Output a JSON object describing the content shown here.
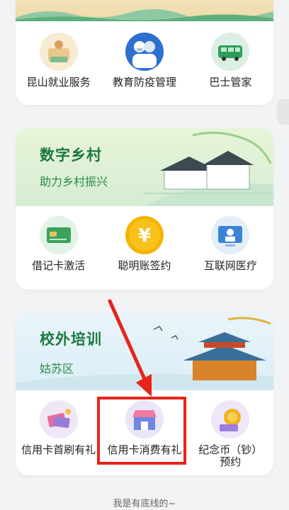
{
  "card1": {
    "items": [
      {
        "label": "昆山就业服务",
        "icon": "employment-service-icon"
      },
      {
        "label": "教育防疫管理",
        "icon": "epidemic-prevention-icon"
      },
      {
        "label": "巴士管家",
        "icon": "bus-icon"
      }
    ]
  },
  "card2": {
    "title": "数字乡村",
    "subtitle": "助力乡村振兴",
    "items": [
      {
        "label": "借记卡激活",
        "icon": "debit-card-icon"
      },
      {
        "label": "聪明账签约",
        "icon": "yuan-coin-icon"
      },
      {
        "label": "互联网医疗",
        "icon": "online-doctor-icon"
      }
    ]
  },
  "card3": {
    "title": "校外培训",
    "subtitle": "姑苏区",
    "items": [
      {
        "label": "信用卡首刷有礼",
        "icon": "credit-card-gift-icon"
      },
      {
        "label": "信用卡消费有礼",
        "icon": "shopping-store-icon"
      },
      {
        "label": "纪念币（钞）预约",
        "icon": "commemorative-coin-icon"
      }
    ]
  },
  "footer": {
    "text": "我是有底线的~"
  },
  "colors": {
    "accent_green": "#1d7a3e",
    "highlight_red": "#e8231a"
  }
}
